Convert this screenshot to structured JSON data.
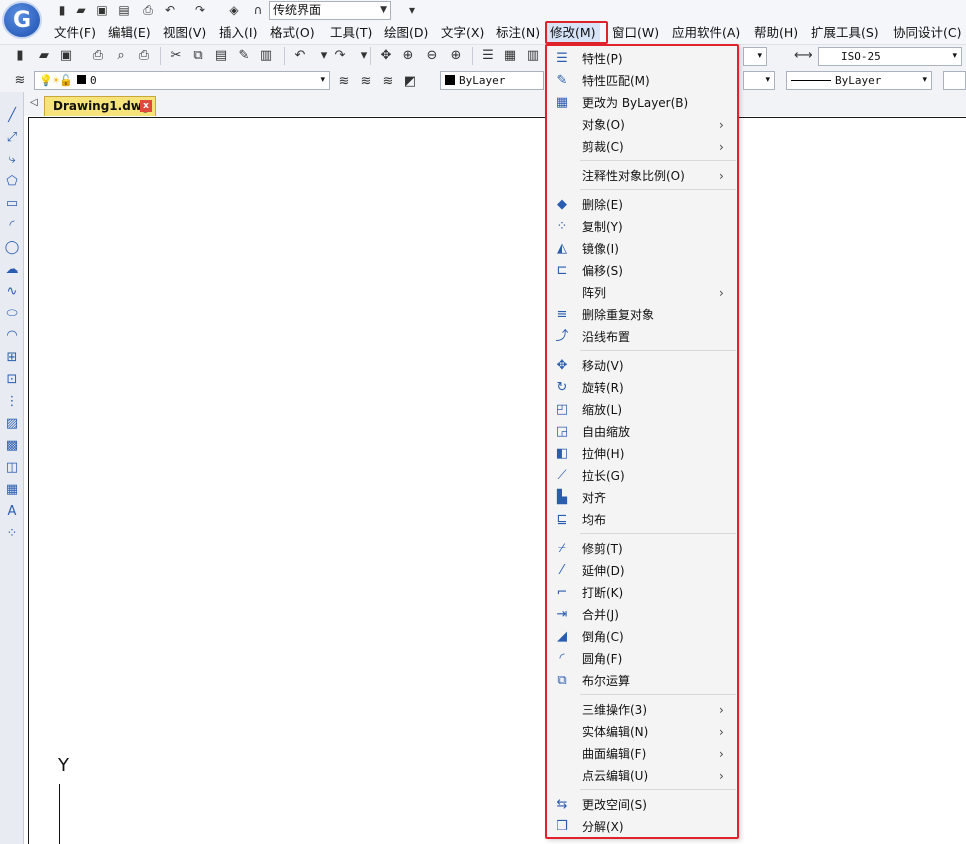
{
  "app": {
    "logo_letter": "G",
    "workspace": "传统界面"
  },
  "quick_access": [
    {
      "icon": "new-file-icon",
      "glyph": "▮"
    },
    {
      "icon": "open-folder-icon",
      "glyph": "▰"
    },
    {
      "icon": "save-icon",
      "glyph": "▣"
    },
    {
      "icon": "save-as-icon",
      "glyph": "▤"
    },
    {
      "icon": "print-icon",
      "glyph": "⎙"
    },
    {
      "icon": "undo-icon",
      "glyph": "↶"
    },
    {
      "icon": "redo-icon",
      "glyph": "↷"
    },
    {
      "icon": "layers-icon",
      "glyph": "◈"
    },
    {
      "icon": "headset-icon",
      "glyph": "∩"
    }
  ],
  "menubar": [
    {
      "label": "文件(F)"
    },
    {
      "label": "编辑(E)"
    },
    {
      "label": "视图(V)"
    },
    {
      "label": "插入(I)"
    },
    {
      "label": "格式(O)"
    },
    {
      "label": "工具(T)"
    },
    {
      "label": "绘图(D)"
    },
    {
      "label": "文字(X)"
    },
    {
      "label": "标注(N)"
    },
    {
      "label": "修改(M)"
    },
    {
      "label": "窗口(W)"
    },
    {
      "label": "应用软件(A)"
    },
    {
      "label": "帮助(H)"
    },
    {
      "label": "扩展工具(S)"
    },
    {
      "label": "协同设计(C)"
    }
  ],
  "toolbar": {
    "dimstyle": "ISO-25",
    "layer_value": "0",
    "color_value": "ByLayer",
    "linetype_value": "ByLayer"
  },
  "document_tab": {
    "title": "Drawing1.dwg",
    "close": "x"
  },
  "ucs": {
    "y_label": "Y"
  },
  "modify_menu": [
    {
      "icon": "properties-icon",
      "glyph": "☰",
      "label": "特性(P)"
    },
    {
      "icon": "match-properties-icon",
      "glyph": "✎",
      "label": "特性匹配(M)"
    },
    {
      "icon": "change-to-bylayer-icon",
      "glyph": "▦",
      "label": "更改为 ByLayer(B)"
    },
    {
      "label": "对象(O)",
      "submenu": true
    },
    {
      "label": "剪裁(C)",
      "submenu": true
    },
    {
      "separator": true
    },
    {
      "label": "注释性对象比例(O)",
      "submenu": true
    },
    {
      "separator": true
    },
    {
      "icon": "erase-icon",
      "glyph": "◆",
      "label": "删除(E)"
    },
    {
      "icon": "copy-icon",
      "glyph": "⁘",
      "label": "复制(Y)"
    },
    {
      "icon": "mirror-icon",
      "glyph": "◭",
      "label": "镜像(I)"
    },
    {
      "icon": "offset-icon",
      "glyph": "⊏",
      "label": "偏移(S)"
    },
    {
      "label": "阵列",
      "submenu": true
    },
    {
      "icon": "delete-duplicates-icon",
      "glyph": "≡",
      "label": "删除重复对象"
    },
    {
      "icon": "path-array-icon",
      "glyph": "⤴",
      "label": "沿线布置"
    },
    {
      "separator": true
    },
    {
      "icon": "move-icon",
      "glyph": "✥",
      "label": "移动(V)"
    },
    {
      "icon": "rotate-icon",
      "glyph": "↻",
      "label": "旋转(R)"
    },
    {
      "icon": "scale-icon",
      "glyph": "◰",
      "label": "缩放(L)"
    },
    {
      "icon": "free-scale-icon",
      "glyph": "◲",
      "label": "自由缩放"
    },
    {
      "icon": "stretch-icon",
      "glyph": "◧",
      "label": "拉伸(H)"
    },
    {
      "icon": "lengthen-icon",
      "glyph": "⟋",
      "label": "拉长(G)"
    },
    {
      "icon": "align-icon",
      "glyph": "▙",
      "label": "对齐"
    },
    {
      "icon": "distribute-icon",
      "glyph": "⊑",
      "label": "均布"
    },
    {
      "separator": true
    },
    {
      "icon": "trim-icon",
      "glyph": "⌿",
      "label": "修剪(T)"
    },
    {
      "icon": "extend-icon",
      "glyph": "⁄",
      "label": "延伸(D)"
    },
    {
      "icon": "break-icon",
      "glyph": "⌐",
      "label": "打断(K)"
    },
    {
      "icon": "join-icon",
      "glyph": "⇥",
      "label": "合并(J)"
    },
    {
      "icon": "chamfer-icon",
      "glyph": "◢",
      "label": "倒角(C)"
    },
    {
      "icon": "fillet-icon",
      "glyph": "◜",
      "label": "圆角(F)"
    },
    {
      "icon": "boolean-icon",
      "glyph": "⧉",
      "label": "布尔运算"
    },
    {
      "separator": true
    },
    {
      "label": "三维操作(3)",
      "submenu": true
    },
    {
      "label": "实体编辑(N)",
      "submenu": true
    },
    {
      "label": "曲面编辑(F)",
      "submenu": true
    },
    {
      "label": "点云编辑(U)",
      "submenu": true
    },
    {
      "separator": true
    },
    {
      "icon": "change-space-icon",
      "glyph": "⇆",
      "label": "更改空间(S)"
    },
    {
      "icon": "explode-icon",
      "glyph": "❒",
      "label": "分解(X)"
    }
  ]
}
